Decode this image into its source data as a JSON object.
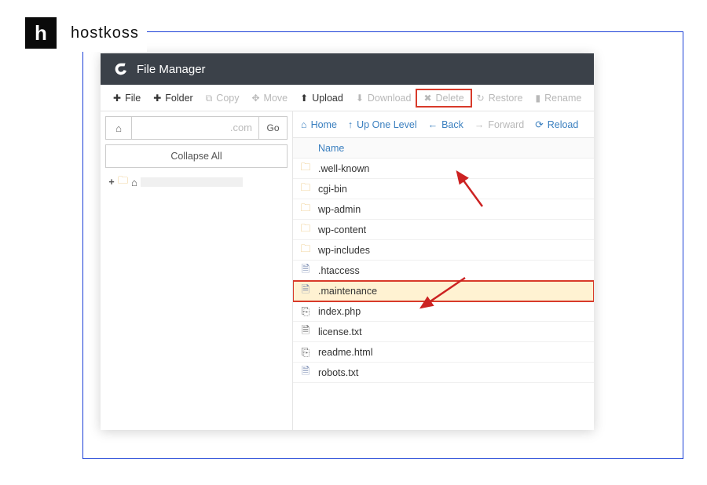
{
  "brand": {
    "logo_letter": "h",
    "name": "hostkoss"
  },
  "app": {
    "title": "File Manager"
  },
  "toolbar": {
    "file": "File",
    "folder": "Folder",
    "copy": "Copy",
    "move": "Move",
    "upload": "Upload",
    "download": "Download",
    "delete": "Delete",
    "restore": "Restore",
    "rename": "Rename"
  },
  "sidebar": {
    "path_suffix": ".com",
    "go": "Go",
    "collapse": "Collapse All"
  },
  "nav": {
    "home": "Home",
    "up": "Up One Level",
    "back": "Back",
    "forward": "Forward",
    "reload": "Reload"
  },
  "listing": {
    "name_header": "Name",
    "items": [
      {
        "name": ".well-known",
        "type": "folder"
      },
      {
        "name": "cgi-bin",
        "type": "folder"
      },
      {
        "name": "wp-admin",
        "type": "folder"
      },
      {
        "name": "wp-content",
        "type": "folder"
      },
      {
        "name": "wp-includes",
        "type": "folder"
      },
      {
        "name": ".htaccess",
        "type": "doc"
      },
      {
        "name": ".maintenance",
        "type": "doc",
        "selected": true
      },
      {
        "name": "index.php",
        "type": "code"
      },
      {
        "name": "license.txt",
        "type": "text"
      },
      {
        "name": "readme.html",
        "type": "code"
      },
      {
        "name": "robots.txt",
        "type": "doc"
      }
    ]
  }
}
